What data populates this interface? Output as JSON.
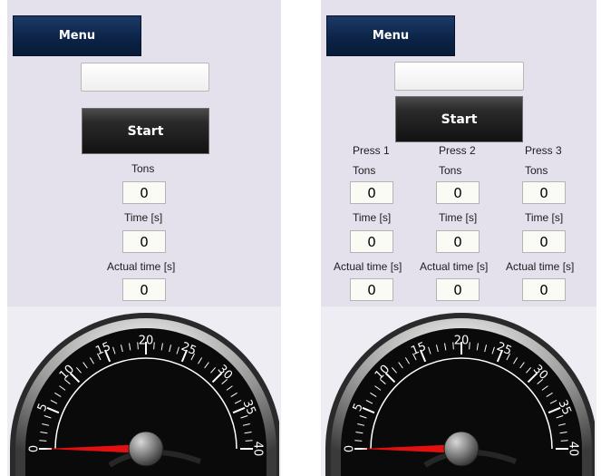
{
  "left": {
    "menu_label": "Menu",
    "code_input": {
      "value": "",
      "placeholder": ""
    },
    "start_label": "Start",
    "fields": [
      {
        "label": "Tons",
        "value": "0"
      },
      {
        "label": "Time [s]",
        "value": "0"
      },
      {
        "label": "Actual time [s]",
        "value": "0"
      }
    ],
    "gauge": {
      "min": 0,
      "max": 40,
      "value": 0,
      "tick_labels": [
        "0",
        "5",
        "10",
        "15",
        "20",
        "25",
        "30",
        "35",
        "40"
      ]
    }
  },
  "right": {
    "menu_label": "Menu",
    "code_input": {
      "value": "",
      "placeholder": ""
    },
    "start_label": "Start",
    "presses": [
      {
        "name": "Press 1",
        "tons_label": "Tons",
        "tons": "0",
        "time_label": "Time [s]",
        "time": "0",
        "actual_label": "Actual time [s]",
        "actual": "0"
      },
      {
        "name": "Press 2",
        "tons_label": "Tons",
        "tons": "0",
        "time_label": "Time [s]",
        "time": "0",
        "actual_label": "Actual time [s]",
        "actual": "0"
      },
      {
        "name": "Press 3",
        "tons_label": "Tons",
        "tons": "0",
        "time_label": "Time [s]",
        "time": "0",
        "actual_label": "Actual time [s]",
        "actual": "0"
      }
    ],
    "gauge": {
      "min": 0,
      "max": 40,
      "value": 0,
      "tick_labels": [
        "0",
        "5",
        "10",
        "15",
        "20",
        "25",
        "30",
        "35",
        "40"
      ]
    }
  },
  "colors": {
    "needle": "#e31010",
    "menu_bg": "#0c2448",
    "panel_bg": "#e4e0ec"
  }
}
